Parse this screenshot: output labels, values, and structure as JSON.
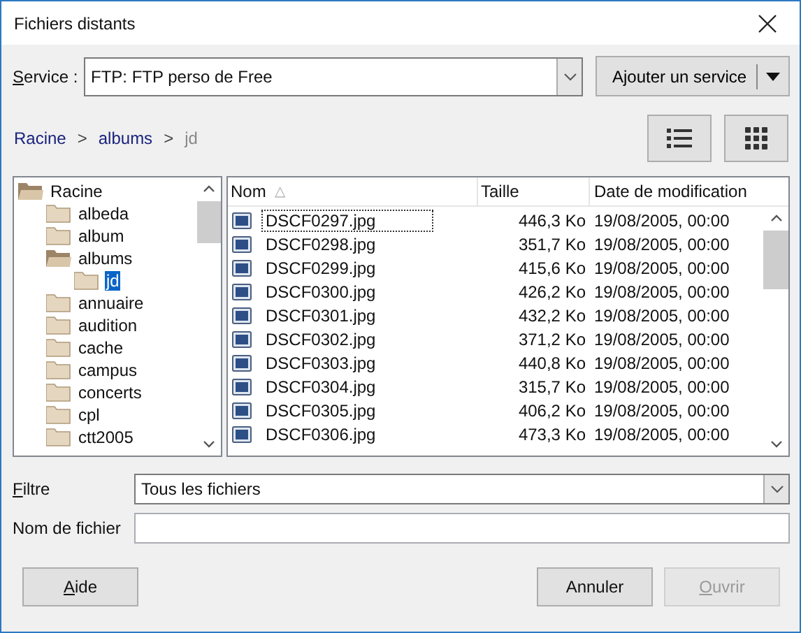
{
  "window": {
    "title": "Fichiers distants"
  },
  "service": {
    "label": "Service :",
    "mnemonic": true,
    "value": "FTP: FTP perso de Free",
    "add_button": "Ajouter un service"
  },
  "breadcrumb": [
    {
      "label": "Racine",
      "current": false
    },
    {
      "label": "albums",
      "current": false
    },
    {
      "label": "jd",
      "current": true
    }
  ],
  "separator": ">",
  "view_buttons": [
    {
      "kind": "list"
    },
    {
      "kind": "grid"
    }
  ],
  "tree": [
    {
      "label": "Racine",
      "expanded": true,
      "selected": false,
      "children": [
        {
          "label": "albeda",
          "expanded": false,
          "selected": false
        },
        {
          "label": "album",
          "expanded": false,
          "selected": false
        },
        {
          "label": "albums",
          "expanded": true,
          "selected": false,
          "children": [
            {
              "label": "jd",
              "expanded": false,
              "selected": true
            }
          ]
        },
        {
          "label": "annuaire",
          "expanded": false,
          "selected": false
        },
        {
          "label": "audition",
          "expanded": false,
          "selected": false
        },
        {
          "label": "cache",
          "expanded": false,
          "selected": false
        },
        {
          "label": "campus",
          "expanded": false,
          "selected": false
        },
        {
          "label": "concerts",
          "expanded": false,
          "selected": false
        },
        {
          "label": "cpl",
          "expanded": false,
          "selected": false
        },
        {
          "label": "ctt2005",
          "expanded": false,
          "selected": false
        }
      ]
    }
  ],
  "table": {
    "columns": [
      {
        "label": "Nom",
        "sorted": true
      },
      {
        "label": "Taille",
        "sorted": false
      },
      {
        "label": "Date de modification",
        "sorted": false
      }
    ],
    "sort_indicator": "△",
    "rows": [
      {
        "name": "DSCF0297.jpg",
        "size": "446,3 Ko",
        "date": "19/08/2005, 00:00",
        "focused": true
      },
      {
        "name": "DSCF0298.jpg",
        "size": "351,7 Ko",
        "date": "19/08/2005, 00:00",
        "focused": false
      },
      {
        "name": "DSCF0299.jpg",
        "size": "415,6 Ko",
        "date": "19/08/2005, 00:00",
        "focused": false
      },
      {
        "name": "DSCF0300.jpg",
        "size": "426,2 Ko",
        "date": "19/08/2005, 00:00",
        "focused": false
      },
      {
        "name": "DSCF0301.jpg",
        "size": "432,2 Ko",
        "date": "19/08/2005, 00:00",
        "focused": false
      },
      {
        "name": "DSCF0302.jpg",
        "size": "371,2 Ko",
        "date": "19/08/2005, 00:00",
        "focused": false
      },
      {
        "name": "DSCF0303.jpg",
        "size": "440,8 Ko",
        "date": "19/08/2005, 00:00",
        "focused": false
      },
      {
        "name": "DSCF0304.jpg",
        "size": "315,7 Ko",
        "date": "19/08/2005, 00:00",
        "focused": false
      },
      {
        "name": "DSCF0305.jpg",
        "size": "406,2 Ko",
        "date": "19/08/2005, 00:00",
        "focused": false
      },
      {
        "name": "DSCF0306.jpg",
        "size": "473,3 Ko",
        "date": "19/08/2005, 00:00",
        "focused": false
      }
    ]
  },
  "filter": {
    "label": "Filtre",
    "mnemonic": true,
    "value": "Tous les fichiers"
  },
  "filename": {
    "label": "Nom de fichier"
  },
  "buttons": [
    {
      "label": "Aide",
      "mnemonic": true,
      "disabled": false,
      "kind": "help"
    },
    {
      "label": "Annuler",
      "mnemonic": false,
      "disabled": false,
      "kind": "action"
    },
    {
      "label": "Ouvrir",
      "mnemonic": true,
      "disabled": true,
      "kind": "action"
    }
  ]
}
